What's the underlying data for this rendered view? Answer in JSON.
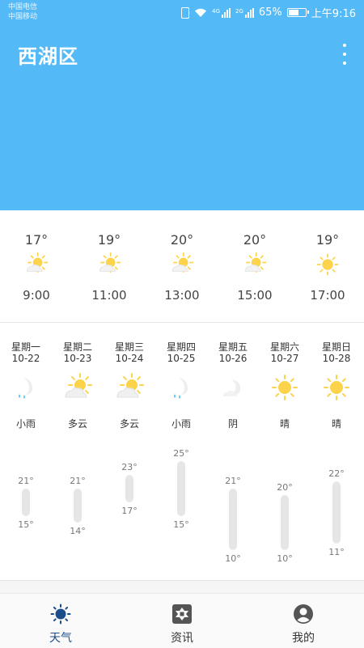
{
  "status": {
    "carrier1": "中国电信",
    "carrier2": "中国移动",
    "sig1_tag": "4G",
    "sig2_tag": "2G",
    "battery": "65%",
    "battery_level": 0.65,
    "time": "上午9:16"
  },
  "header": {
    "city": "西湖区"
  },
  "hourly": [
    {
      "temp": "17°",
      "time": "9:00",
      "icon": "partly-sunny-icon"
    },
    {
      "temp": "19°",
      "time": "11:00",
      "icon": "partly-sunny-icon"
    },
    {
      "temp": "20°",
      "time": "13:00",
      "icon": "partly-sunny-icon"
    },
    {
      "temp": "20°",
      "time": "15:00",
      "icon": "partly-sunny-icon"
    },
    {
      "temp": "19°",
      "time": "17:00",
      "icon": "sun-icon"
    }
  ],
  "daily": [
    {
      "weekday": "星期一",
      "date": "10-22",
      "cond": "小雨",
      "icon": "rain-icon",
      "high": "21°",
      "low": "15°",
      "high_value": 21,
      "low_value": 15
    },
    {
      "weekday": "星期二",
      "date": "10-23",
      "cond": "多云",
      "icon": "cloudy-icon",
      "high": "21°",
      "low": "14°",
      "high_value": 21,
      "low_value": 14
    },
    {
      "weekday": "星期三",
      "date": "10-24",
      "cond": "多云",
      "icon": "cloudy-icon",
      "high": "23°",
      "low": "17°",
      "high_value": 23,
      "low_value": 17
    },
    {
      "weekday": "星期四",
      "date": "10-25",
      "cond": "小雨",
      "icon": "rain-icon",
      "high": "25°",
      "low": "15°",
      "high_value": 25,
      "low_value": 15
    },
    {
      "weekday": "星期五",
      "date": "10-26",
      "cond": "阴",
      "icon": "overcast-icon",
      "high": "21°",
      "low": "10°",
      "high_value": 21,
      "low_value": 10
    },
    {
      "weekday": "星期六",
      "date": "10-27",
      "cond": "晴",
      "icon": "sun-icon",
      "high": "20°",
      "low": "10°",
      "high_value": 20,
      "low_value": 10
    },
    {
      "weekday": "星期日",
      "date": "10-28",
      "cond": "晴",
      "icon": "sun-icon",
      "high": "22°",
      "low": "11°",
      "high_value": 22,
      "low_value": 11
    }
  ],
  "nav": [
    {
      "label": "天气",
      "icon": "weather-sun-icon",
      "active": true
    },
    {
      "label": "资讯",
      "icon": "news-icon",
      "active": false
    },
    {
      "label": "我的",
      "icon": "profile-icon",
      "active": false
    }
  ],
  "colors": {
    "header": "#53baf7",
    "sun": "#fcd34a",
    "active_nav": "#1a4d8a"
  }
}
